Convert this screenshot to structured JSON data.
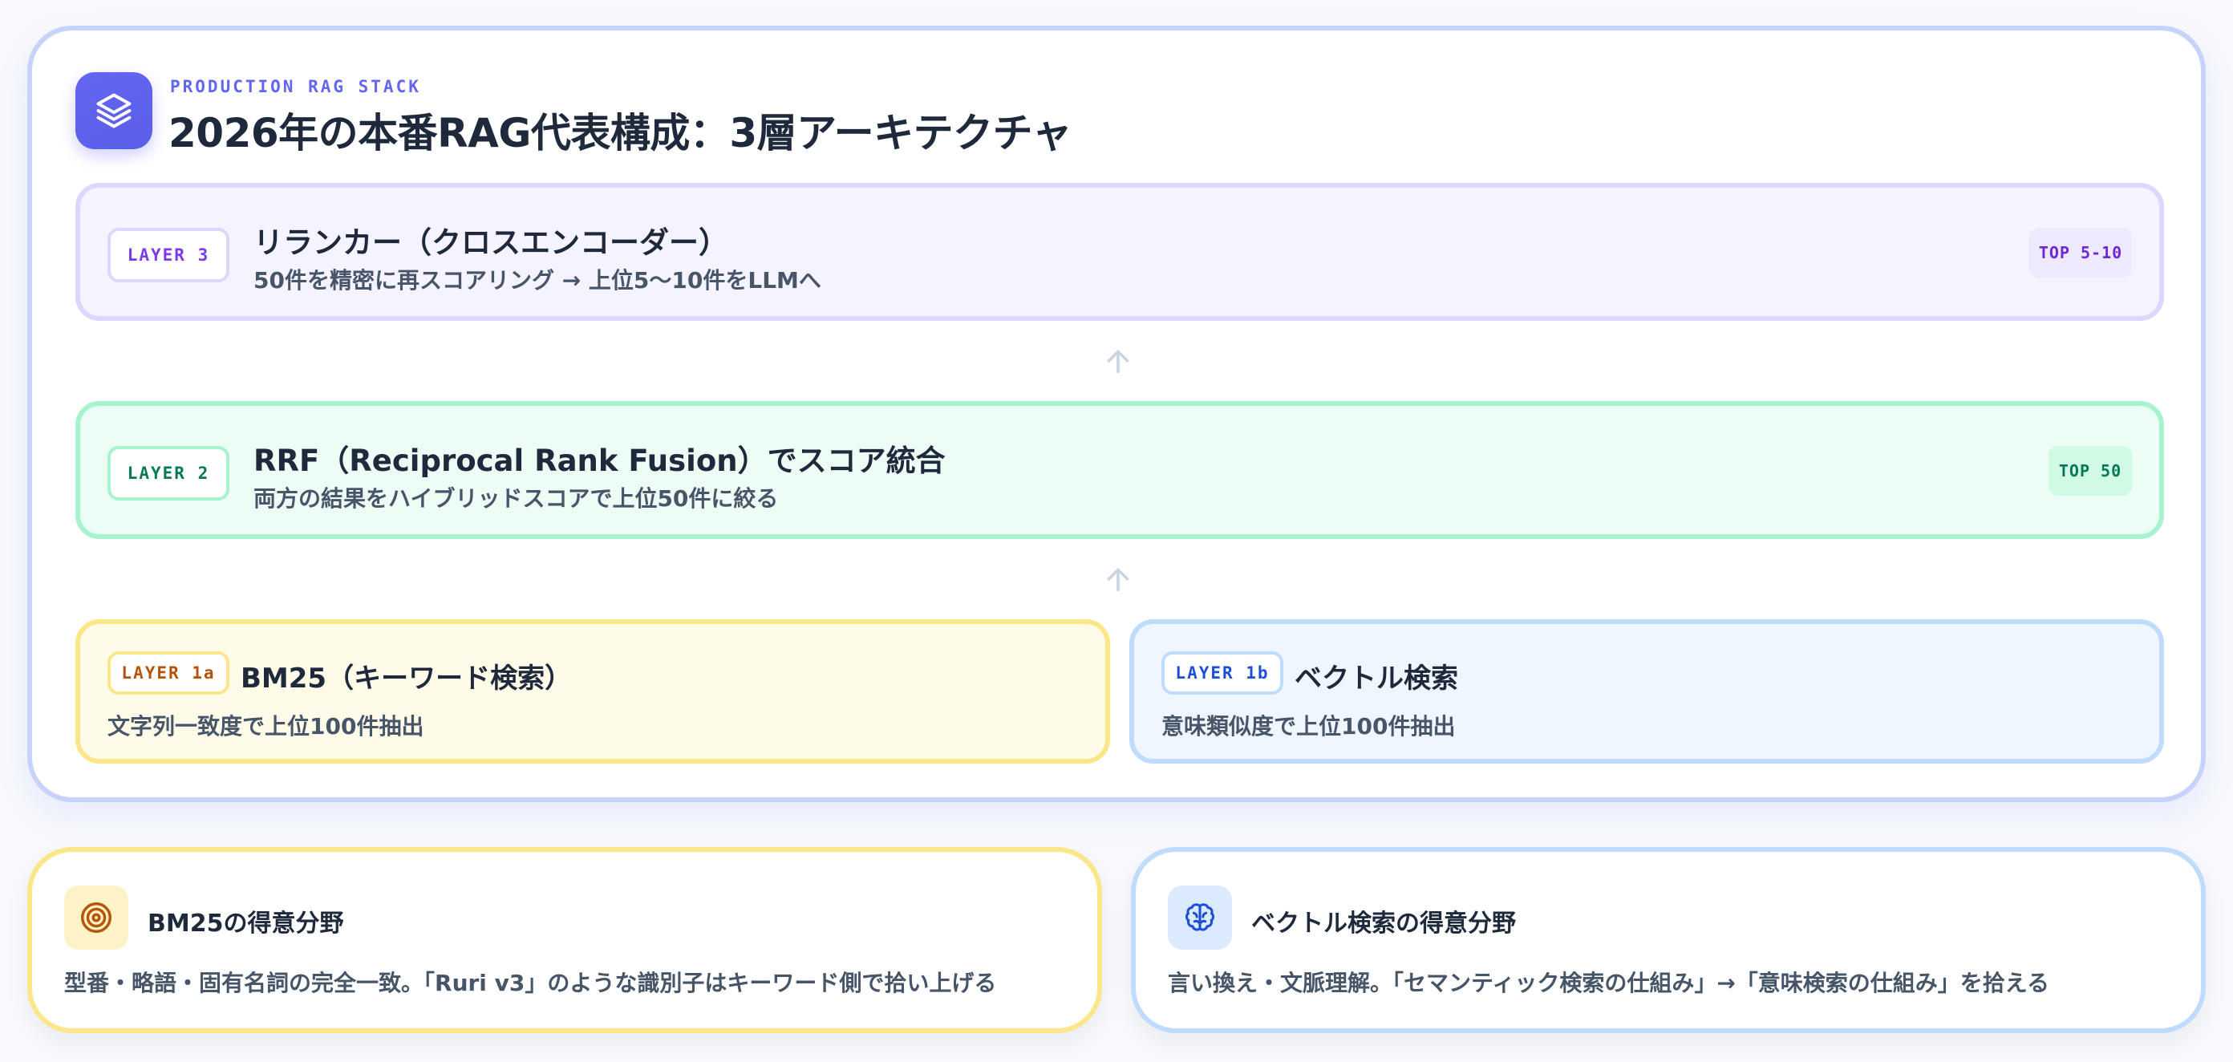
{
  "header": {
    "eyebrow": "PRODUCTION RAG STACK",
    "title": "2026年の本番RAG代表構成：3層アーキテクチャ",
    "icon": "layers-icon"
  },
  "layers": {
    "layer3": {
      "label": "LAYER 3",
      "title": "リランカー（クロスエンコーダー）",
      "description": "50件を精密に再スコアリング → 上位5〜10件をLLMへ",
      "badge": "TOP 5-10",
      "color": "#7c3aed"
    },
    "layer2": {
      "label": "LAYER 2",
      "title": "RRF（Reciprocal Rank Fusion）でスコア統合",
      "description": "両方の結果をハイブリッドスコアで上位50件に絞る",
      "badge": "TOP 50",
      "color": "#047857"
    },
    "layer1a": {
      "label": "LAYER 1a",
      "title": "BM25（キーワード検索）",
      "description": "文字列一致度で上位100件抽出",
      "color": "#b45309"
    },
    "layer1b": {
      "label": "LAYER 1b",
      "title": "ベクトル検索",
      "description": "意味類似度で上位100件抽出",
      "color": "#1d4ed8"
    }
  },
  "cards": {
    "bm25": {
      "icon": "target-icon",
      "title": "BM25の得意分野",
      "description": "型番・略語・固有名詞の完全一致。「Ruri v3」のような識別子はキーワード側で拾い上げる"
    },
    "vector": {
      "icon": "brain-icon",
      "title": "ベクトル検索の得意分野",
      "description": "言い換え・文脈理解。「セマンティック検索の仕組み」→「意味検索の仕組み」を拾える"
    }
  },
  "colors": {
    "accent": "#6366f1",
    "panel_border": "#c7d2fe",
    "arrow": "#cbd5e1"
  }
}
